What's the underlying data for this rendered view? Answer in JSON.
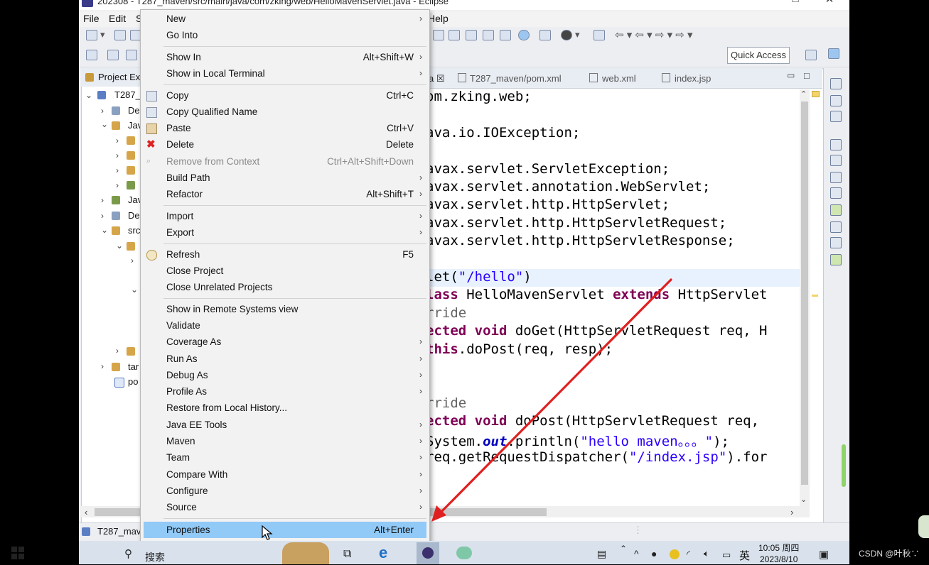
{
  "window": {
    "title": "202308 - T287_maven/src/main/java/com/zking/web/HelloMavenServlet.java - Eclipse"
  },
  "menubar": {
    "file": "File",
    "edit": "Edit",
    "s": "S",
    "help": "Help"
  },
  "quick_access": "Quick Access",
  "project_explorer": {
    "title": "Project Ex",
    "items": [
      "T287_",
      "De",
      "Jav",
      "Jav",
      "De",
      "src",
      "tar",
      "po"
    ]
  },
  "editor": {
    "tabs": [
      {
        "label": "a"
      },
      {
        "label": "T287_maven/pom.xml"
      },
      {
        "label": "web.xml"
      },
      {
        "label": "index.jsp"
      }
    ],
    "lines": {
      "l1": "om.zking.web;",
      "l2": "ava.io.IOException;",
      "l3": "avax.servlet.ServletException;",
      "l4": "avax.servlet.annotation.WebServlet;",
      "l5": "avax.servlet.http.HttpServlet;",
      "l6": "avax.servlet.http.HttpServletRequest;",
      "l7": "avax.servlet.http.HttpServletResponse;",
      "l8a": "let(",
      "l8b": "\"/hello\"",
      "l8c": ")",
      "l9a": "lass ",
      "l9b": "HelloMavenServlet ",
      "l9c": "extends ",
      "l9d": "HttpServlet",
      "l10": "rride",
      "l11a": "ected ",
      "l11b": "void ",
      "l11c": "doGet(HttpServletRequest req, H",
      "l12a": "this",
      "l12b": ".doPost(req, resp);",
      "l13": "rride",
      "l14a": "ected ",
      "l14b": "void ",
      "l14c": "doPost(HttpServletRequest req,",
      "l15a": "System.",
      "l15b": "out",
      "l15c": ".println(",
      "l15d": "\"hello maven。。。\"",
      "l15e": ");",
      "l16a": "req.getRequestDispatcher(",
      "l16b": "\"/index.jsp\"",
      "l16c": ").for"
    }
  },
  "status": {
    "project": "T287_mav"
  },
  "context_menu": {
    "items": [
      {
        "label": "New",
        "shortcut": "",
        "submenu": true
      },
      {
        "label": "Go Into",
        "shortcut": ""
      },
      {
        "label": "Show In",
        "shortcut": "Alt+Shift+W",
        "submenu": true
      },
      {
        "label": "Show in Local Terminal",
        "shortcut": "",
        "submenu": true
      },
      {
        "label": "Copy",
        "shortcut": "Ctrl+C"
      },
      {
        "label": "Copy Qualified Name",
        "shortcut": ""
      },
      {
        "label": "Paste",
        "shortcut": "Ctrl+V"
      },
      {
        "label": "Delete",
        "shortcut": "Delete"
      },
      {
        "label": "Remove from Context",
        "shortcut": "Ctrl+Alt+Shift+Down",
        "disabled": true
      },
      {
        "label": "Build Path",
        "shortcut": "",
        "submenu": true
      },
      {
        "label": "Refactor",
        "shortcut": "Alt+Shift+T",
        "submenu": true
      },
      {
        "label": "Import",
        "shortcut": "",
        "submenu": true
      },
      {
        "label": "Export",
        "shortcut": "",
        "submenu": true
      },
      {
        "label": "Refresh",
        "shortcut": "F5"
      },
      {
        "label": "Close Project",
        "shortcut": ""
      },
      {
        "label": "Close Unrelated Projects",
        "shortcut": ""
      },
      {
        "label": "Show in Remote Systems view",
        "shortcut": ""
      },
      {
        "label": "Validate",
        "shortcut": ""
      },
      {
        "label": "Coverage As",
        "shortcut": "",
        "submenu": true
      },
      {
        "label": "Run As",
        "shortcut": "",
        "submenu": true
      },
      {
        "label": "Debug As",
        "shortcut": "",
        "submenu": true
      },
      {
        "label": "Profile As",
        "shortcut": "",
        "submenu": true
      },
      {
        "label": "Restore from Local History...",
        "shortcut": ""
      },
      {
        "label": "Java EE Tools",
        "shortcut": "",
        "submenu": true
      },
      {
        "label": "Maven",
        "shortcut": "",
        "submenu": true
      },
      {
        "label": "Team",
        "shortcut": "",
        "submenu": true
      },
      {
        "label": "Compare With",
        "shortcut": "",
        "submenu": true
      },
      {
        "label": "Configure",
        "shortcut": "",
        "submenu": true
      },
      {
        "label": "Source",
        "shortcut": "",
        "submenu": true
      },
      {
        "label": "Properties",
        "shortcut": "Alt+Enter",
        "selected": true
      }
    ]
  },
  "taskbar": {
    "search": "搜索",
    "lang": "英",
    "time": "10:05 周四",
    "date": "2023/8/10"
  },
  "watermark": "CSDN @叶秋∵",
  "colors": {
    "menu_selected": "#91c9f7",
    "keyword": "#7f0055",
    "string": "#2a00ff",
    "annotation_arrow": "#e02020"
  }
}
